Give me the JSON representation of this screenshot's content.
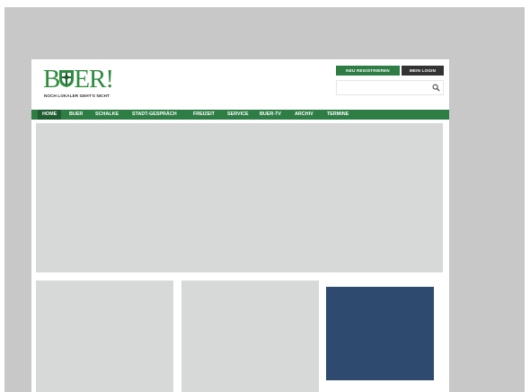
{
  "brand": {
    "logo_left": "B",
    "logo_right": "ER!",
    "tagline": "NOCH LOKALER GEHT'S NICHT",
    "color": "#2e8b3f"
  },
  "header": {
    "register_label": "NEU REGISTRIEREN",
    "login_label": "MEIN LOGIN",
    "search_placeholder": ""
  },
  "nav": {
    "items": [
      {
        "label": "HOME",
        "active": true
      },
      {
        "label": "BUER"
      },
      {
        "label": "SCHALKE"
      },
      {
        "label": "STADT-GESPRÄCH"
      },
      {
        "label": "FREIZEIT"
      },
      {
        "label": "SERVICE"
      },
      {
        "label": "BUER-TV"
      },
      {
        "label": "ARCHIV"
      },
      {
        "label": "TERMINE"
      }
    ]
  },
  "colors": {
    "nav_green": "#2e7d45",
    "nav_active": "#1f5c31",
    "placeholder_gray": "#d7d9d8",
    "ad_blue": "#2e4a6f",
    "outer_gray": "#c8c8c8"
  }
}
